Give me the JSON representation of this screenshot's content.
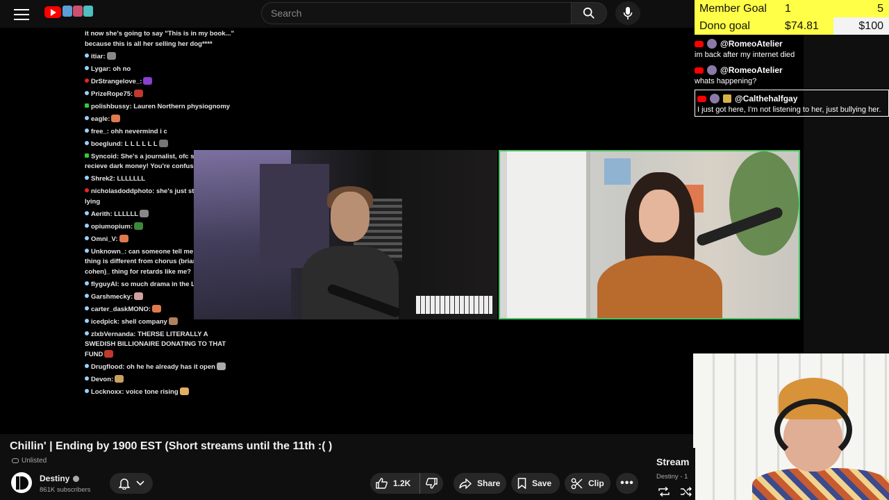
{
  "header": {
    "menu_icon": "hamburger-menu-icon",
    "logo_icon": "youtube-logo-icon",
    "search_placeholder": "Search",
    "search_icon": "search-icon",
    "mic_icon": "microphone-icon"
  },
  "stream_chat": {
    "messages": [
      {
        "user": "",
        "text": "it now she's going to say \"This is in my book...\" because this is all her selling her dog****",
        "dot": "none"
      },
      {
        "user": "itiar",
        "text": ":",
        "dot": "blue",
        "emote": "#888"
      },
      {
        "user": "Lygar",
        "text": ": oh no",
        "dot": "blue"
      },
      {
        "user": "DrStrangelove_",
        "text": ":",
        "dot": "red",
        "emote": "#8a3fcf"
      },
      {
        "user": "PrizeRope75",
        "text": ":",
        "dot": "blue",
        "emote": "#c0392b"
      },
      {
        "user": "polishbussy",
        "text": ": Lauren Northern physiognomy",
        "dot": "green"
      },
      {
        "user": "eagle",
        "text": ":",
        "dot": "blue",
        "emote": "#e07a4e"
      },
      {
        "user": "free_",
        "text": ": ohh nevermind i c",
        "dot": "blue"
      },
      {
        "user": "boeglund",
        "text": ": L L L L L L",
        "dot": "blue",
        "emote": "#777"
      },
      {
        "user": "Syncoid",
        "text": ": She's a journalist, ofc she can't recieve dark money! You're confused Destiny",
        "dot": "green"
      },
      {
        "user": "Shrek2",
        "text": ": LLLLLLL",
        "dot": "blue"
      },
      {
        "user": "nicholasdoddphoto",
        "text": ": she's just straigjt up lying",
        "dot": "red"
      },
      {
        "user": "Aerith",
        "text": ": LLLLLL",
        "dot": "blue",
        "emote": "#888"
      },
      {
        "user": "opiumopium",
        "text": ":",
        "dot": "blue",
        "emote": "#3a8a3a"
      },
      {
        "user": "Omni_V",
        "text": ":",
        "dot": "blue",
        "emote": "#e07a4e"
      },
      {
        "user": "Unknown_",
        "text": ": can someone tell me how taylor's thing is different from chorus (brian tyler cohen)_ thing for retards like me?",
        "dot": "blue"
      },
      {
        "user": "flyguyAI",
        "text": ": so much drama in the LLC",
        "dot": "blue",
        "emote": "#3a8a3a"
      },
      {
        "user": "Garshmecky",
        "text": ":",
        "dot": "blue",
        "emote": "#d0a0a0"
      },
      {
        "user": "carter_daskMONO",
        "text": ":",
        "dot": "blue",
        "emote": "#e07a4e"
      },
      {
        "user": "icedpick",
        "text": ": shell company",
        "dot": "blue",
        "emote": "#b08060"
      },
      {
        "user": "zlxbVernanda",
        "text": ": THERSE LITERALLY A SWEDISH BILLIONAIRE DONATING TO THAT FUND",
        "dot": "blue",
        "emote": "#c0392b"
      },
      {
        "user": "Drugflood",
        "text": ": oh he he already has it open",
        "dot": "blue",
        "emote": "#aaa"
      },
      {
        "user": "Devon",
        "text": ":",
        "dot": "blue",
        "emote": "#c8a060"
      },
      {
        "user": "Locknoxx",
        "text": ": voice tone rising",
        "dot": "blue",
        "emote": "#e0b060"
      }
    ]
  },
  "goals": {
    "member_label": "Member Goal",
    "member_current": "1",
    "member_target": "5",
    "dono_label": "Dono goal",
    "dono_current": "$74.81",
    "dono_target": "$100",
    "dono_progress": 0.7481
  },
  "alerts": [
    {
      "user": "@RomeoAtelier",
      "message": "im back after my internet died",
      "boxed": false,
      "badge": false
    },
    {
      "user": "@RomeoAtelier",
      "message": "whats happening?",
      "boxed": false,
      "badge": false
    },
    {
      "user": "@Calthehalfgay",
      "message": "I just got here, I'm not listening to her, just bullying her.",
      "boxed": true,
      "badge": true
    }
  ],
  "video": {
    "title": "Chillin' | Ending by 1900 EST (Short streams until the 11th :( )",
    "visibility": "Unlisted",
    "channel_name": "Destiny",
    "subscribers": "861K subscribers",
    "like_count": "1.2K",
    "share_label": "Share",
    "save_label": "Save",
    "clip_label": "Clip",
    "more_label": "•••"
  },
  "side_panel": {
    "title": "Stream",
    "subtitle": "Destiny - 1"
  },
  "colors": {
    "accent_red": "#ff0000",
    "goal_yellow": "#ffff47",
    "cam_border_green": "#47c464"
  }
}
